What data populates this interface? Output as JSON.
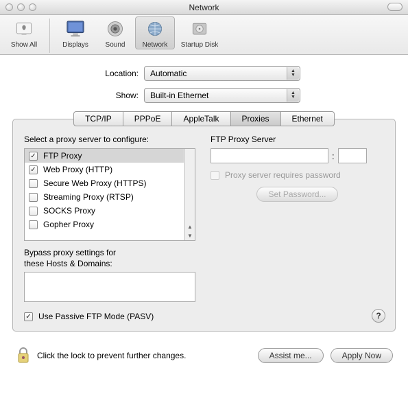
{
  "window": {
    "title": "Network"
  },
  "toolbar": {
    "show_all": "Show All",
    "displays": "Displays",
    "sound": "Sound",
    "network": "Network",
    "startup_disk": "Startup Disk"
  },
  "location": {
    "label": "Location:",
    "value": "Automatic"
  },
  "show": {
    "label": "Show:",
    "value": "Built-in Ethernet"
  },
  "tabs": {
    "tcpip": "TCP/IP",
    "pppoe": "PPPoE",
    "appletalk": "AppleTalk",
    "proxies": "Proxies",
    "ethernet": "Ethernet"
  },
  "proxies": {
    "select_label": "Select a proxy server to configure:",
    "items": [
      {
        "label": "FTP Proxy",
        "checked": true,
        "selected": true
      },
      {
        "label": "Web Proxy (HTTP)",
        "checked": true,
        "selected": false
      },
      {
        "label": "Secure Web Proxy (HTTPS)",
        "checked": false,
        "selected": false
      },
      {
        "label": "Streaming Proxy (RTSP)",
        "checked": false,
        "selected": false
      },
      {
        "label": "SOCKS Proxy",
        "checked": false,
        "selected": false
      },
      {
        "label": "Gopher Proxy",
        "checked": false,
        "selected": false
      }
    ],
    "bypass_label": "Bypass proxy settings for\nthese Hosts & Domains:",
    "bypass_value": "",
    "passive_label": "Use Passive FTP Mode (PASV)",
    "passive_checked": true
  },
  "ftp_server": {
    "label": "FTP Proxy Server",
    "host": "",
    "port": "",
    "requires_pw_label": "Proxy server requires password",
    "requires_pw_checked": false,
    "set_password_label": "Set Password..."
  },
  "help_label": "?",
  "footer": {
    "lock_text": "Click the lock to prevent further changes.",
    "assist_label": "Assist me...",
    "apply_label": "Apply Now"
  }
}
